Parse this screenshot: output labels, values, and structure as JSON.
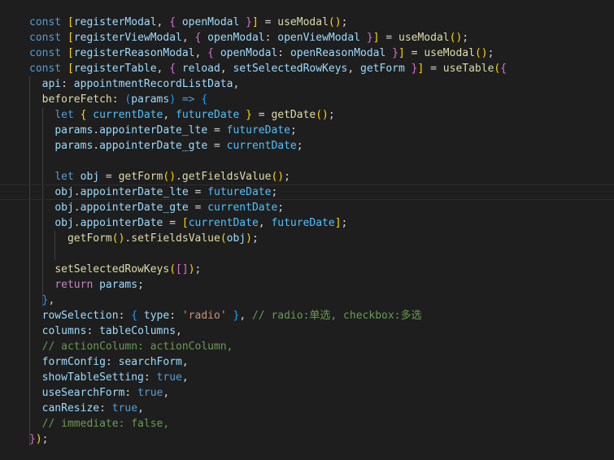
{
  "editor": {
    "lines": [
      [
        [
          "k",
          "const "
        ],
        [
          "br1",
          "["
        ],
        [
          "v",
          "registerModal"
        ],
        [
          "p",
          ", "
        ],
        [
          "br2",
          "{ "
        ],
        [
          "v",
          "openModal "
        ],
        [
          "br2",
          "}"
        ],
        [
          "br1",
          "]"
        ],
        [
          "p",
          " = "
        ],
        [
          "f",
          "useModal"
        ],
        [
          "br1",
          "()"
        ],
        [
          "p",
          ";"
        ]
      ],
      [
        [
          "k",
          "const "
        ],
        [
          "br1",
          "["
        ],
        [
          "v",
          "registerViewModal"
        ],
        [
          "p",
          ", "
        ],
        [
          "br2",
          "{ "
        ],
        [
          "v",
          "openModal"
        ],
        [
          "p",
          ": "
        ],
        [
          "v",
          "openViewModal "
        ],
        [
          "br2",
          "}"
        ],
        [
          "br1",
          "]"
        ],
        [
          "p",
          " = "
        ],
        [
          "f",
          "useModal"
        ],
        [
          "br1",
          "()"
        ],
        [
          "p",
          ";"
        ]
      ],
      [
        [
          "k",
          "const "
        ],
        [
          "br1",
          "["
        ],
        [
          "v",
          "registerReasonModal"
        ],
        [
          "p",
          ", "
        ],
        [
          "br2",
          "{ "
        ],
        [
          "v",
          "openModal"
        ],
        [
          "p",
          ": "
        ],
        [
          "v",
          "openReasonModal "
        ],
        [
          "br2",
          "}"
        ],
        [
          "br1",
          "]"
        ],
        [
          "p",
          " = "
        ],
        [
          "f",
          "useModal"
        ],
        [
          "br1",
          "()"
        ],
        [
          "p",
          ";"
        ]
      ],
      [
        [
          "k",
          "const "
        ],
        [
          "br1",
          "["
        ],
        [
          "v",
          "registerTable"
        ],
        [
          "p",
          ", "
        ],
        [
          "br2",
          "{ "
        ],
        [
          "v",
          "reload"
        ],
        [
          "p",
          ", "
        ],
        [
          "v",
          "setSelectedRowKeys"
        ],
        [
          "p",
          ", "
        ],
        [
          "v",
          "getForm "
        ],
        [
          "br2",
          "}"
        ],
        [
          "br1",
          "]"
        ],
        [
          "p",
          " = "
        ],
        [
          "f",
          "useTable"
        ],
        [
          "br1",
          "("
        ],
        [
          "br2",
          "{"
        ]
      ],
      [
        [
          "p",
          "  "
        ],
        [
          "v",
          "api"
        ],
        [
          "p",
          ": "
        ],
        [
          "v",
          "appointmentRecordListData"
        ],
        [
          "p",
          ","
        ]
      ],
      [
        [
          "p",
          "  "
        ],
        [
          "f",
          "beforeFetch"
        ],
        [
          "p",
          ": "
        ],
        [
          "br3",
          "("
        ],
        [
          "v",
          "params"
        ],
        [
          "br3",
          ")"
        ],
        [
          "p",
          " "
        ],
        [
          "k",
          "=>"
        ],
        [
          "p",
          " "
        ],
        [
          "br3",
          "{"
        ]
      ],
      [
        [
          "p",
          "    "
        ],
        [
          "k",
          "let "
        ],
        [
          "br1",
          "{ "
        ],
        [
          "c2",
          "currentDate"
        ],
        [
          "p",
          ", "
        ],
        [
          "c2",
          "futureDate "
        ],
        [
          "br1",
          "}"
        ],
        [
          "p",
          " = "
        ],
        [
          "f",
          "getDate"
        ],
        [
          "br1",
          "()"
        ],
        [
          "p",
          ";"
        ]
      ],
      [
        [
          "p",
          "    "
        ],
        [
          "v",
          "params"
        ],
        [
          "p",
          "."
        ],
        [
          "v",
          "appointerDate_lte"
        ],
        [
          "p",
          " = "
        ],
        [
          "c2",
          "futureDate"
        ],
        [
          "p",
          ";"
        ]
      ],
      [
        [
          "p",
          "    "
        ],
        [
          "v",
          "params"
        ],
        [
          "p",
          "."
        ],
        [
          "v",
          "appointerDate_gte"
        ],
        [
          "p",
          " = "
        ],
        [
          "c2",
          "currentDate"
        ],
        [
          "p",
          ";"
        ]
      ],
      [],
      [
        [
          "p",
          "    "
        ],
        [
          "k",
          "let "
        ],
        [
          "v",
          "obj"
        ],
        [
          "p",
          " = "
        ],
        [
          "f",
          "getForm"
        ],
        [
          "br1",
          "()"
        ],
        [
          "p",
          "."
        ],
        [
          "f",
          "getFieldsValue"
        ],
        [
          "br1",
          "()"
        ],
        [
          "p",
          ";"
        ]
      ],
      [
        [
          "p",
          "    "
        ],
        [
          "v",
          "obj"
        ],
        [
          "p",
          "."
        ],
        [
          "v",
          "appointerDate_lte"
        ],
        [
          "p",
          " = "
        ],
        [
          "c2",
          "futureDate"
        ],
        [
          "p",
          ";"
        ]
      ],
      [
        [
          "p",
          "    "
        ],
        [
          "v",
          "obj"
        ],
        [
          "p",
          "."
        ],
        [
          "v",
          "appointerDate_gte"
        ],
        [
          "p",
          " = "
        ],
        [
          "c2",
          "currentDate"
        ],
        [
          "p",
          ";"
        ]
      ],
      [
        [
          "p",
          "    "
        ],
        [
          "v",
          "obj"
        ],
        [
          "p",
          "."
        ],
        [
          "v",
          "appointerDate"
        ],
        [
          "p",
          " = "
        ],
        [
          "br1",
          "["
        ],
        [
          "c2",
          "currentDate"
        ],
        [
          "p",
          ", "
        ],
        [
          "c2",
          "futureDate"
        ],
        [
          "br1",
          "]"
        ],
        [
          "p",
          ";"
        ]
      ],
      [
        [
          "p",
          "      "
        ],
        [
          "f",
          "getForm"
        ],
        [
          "br1",
          "()"
        ],
        [
          "p",
          "."
        ],
        [
          "f",
          "setFieldsValue"
        ],
        [
          "br1",
          "("
        ],
        [
          "v",
          "obj"
        ],
        [
          "br1",
          ")"
        ],
        [
          "p",
          ";"
        ]
      ],
      [],
      [
        [
          "p",
          "    "
        ],
        [
          "f",
          "setSelectedRowKeys"
        ],
        [
          "br1",
          "("
        ],
        [
          "br2",
          "[]"
        ],
        [
          "br1",
          ")"
        ],
        [
          "p",
          ";"
        ]
      ],
      [
        [
          "p",
          "    "
        ],
        [
          "kc",
          "return "
        ],
        [
          "v",
          "params"
        ],
        [
          "p",
          ";"
        ]
      ],
      [
        [
          "p",
          "  "
        ],
        [
          "br3",
          "}"
        ],
        [
          "p",
          ","
        ]
      ],
      [
        [
          "p",
          "  "
        ],
        [
          "v",
          "rowSelection"
        ],
        [
          "p",
          ": "
        ],
        [
          "br3",
          "{ "
        ],
        [
          "v",
          "type"
        ],
        [
          "p",
          ": "
        ],
        [
          "s",
          "'radio'"
        ],
        [
          "br3",
          " }"
        ],
        [
          "p",
          ", "
        ],
        [
          "cm",
          "// radio:单选, checkbox:多选"
        ]
      ],
      [
        [
          "p",
          "  "
        ],
        [
          "v",
          "columns"
        ],
        [
          "p",
          ": "
        ],
        [
          "v",
          "tableColumns"
        ],
        [
          "p",
          ","
        ]
      ],
      [
        [
          "p",
          "  "
        ],
        [
          "cm",
          "// actionColumn: actionColumn,"
        ]
      ],
      [
        [
          "p",
          "  "
        ],
        [
          "v",
          "formConfig"
        ],
        [
          "p",
          ": "
        ],
        [
          "v",
          "searchForm"
        ],
        [
          "p",
          ","
        ]
      ],
      [
        [
          "p",
          "  "
        ],
        [
          "v",
          "showTableSetting"
        ],
        [
          "p",
          ": "
        ],
        [
          "b",
          "true"
        ],
        [
          "p",
          ","
        ]
      ],
      [
        [
          "p",
          "  "
        ],
        [
          "v",
          "useSearchForm"
        ],
        [
          "p",
          ": "
        ],
        [
          "b",
          "true"
        ],
        [
          "p",
          ","
        ]
      ],
      [
        [
          "p",
          "  "
        ],
        [
          "v",
          "canResize"
        ],
        [
          "p",
          ": "
        ],
        [
          "b",
          "true"
        ],
        [
          "p",
          ","
        ]
      ],
      [
        [
          "p",
          "  "
        ],
        [
          "cm",
          "// immediate: false,"
        ]
      ],
      [
        [
          "br2",
          "}"
        ],
        [
          "br1",
          ")"
        ],
        [
          "p",
          ";"
        ]
      ]
    ]
  }
}
